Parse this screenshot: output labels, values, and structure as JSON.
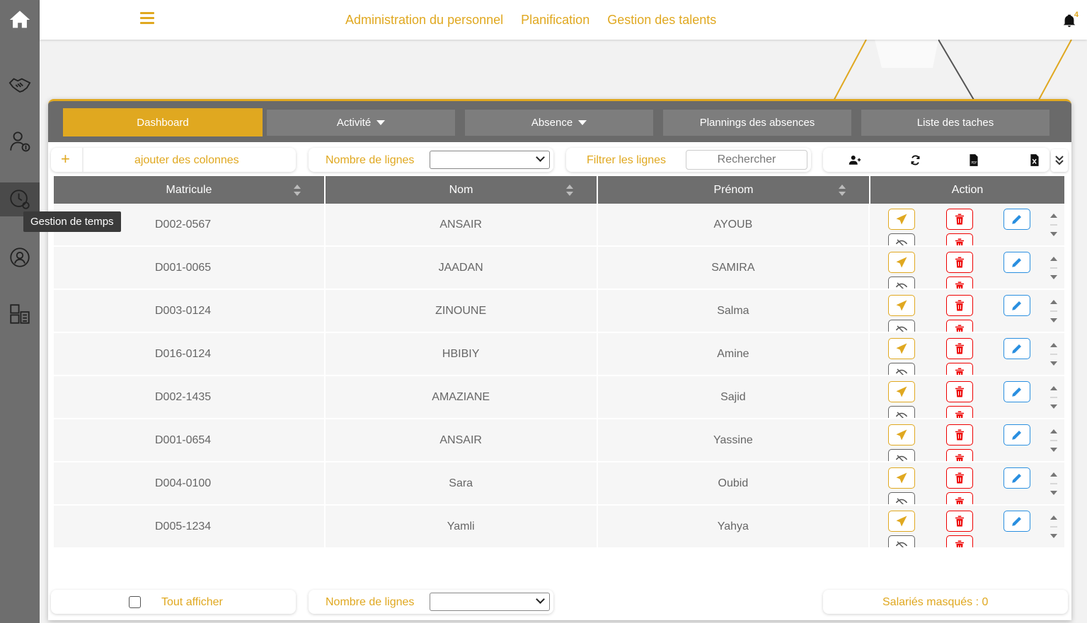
{
  "tooltip": "Gestion de temps",
  "topnav": {
    "items": [
      "Administration du personnel",
      "Planification",
      "Gestion des talents"
    ],
    "notification_count": "4"
  },
  "tabs": [
    {
      "label": "Dashboard",
      "active": true
    },
    {
      "label": "Activité",
      "dropdown": true
    },
    {
      "label": "Absence",
      "dropdown": true
    },
    {
      "label": "Plannings des absences"
    },
    {
      "label": "Liste des taches"
    }
  ],
  "toolbar": {
    "add_columns": "ajouter des colonnes",
    "rows_label": "Nombre de lignes",
    "filter_label": "Filtrer les lignes",
    "search_placeholder": "Rechercher"
  },
  "table": {
    "columns": [
      "Matricule",
      "Nom",
      "Prénom",
      "Action"
    ],
    "rows": [
      [
        "D002-0567",
        "ANSAIR",
        "AYOUB"
      ],
      [
        "D001-0065",
        "JAADAN",
        "SAMIRA"
      ],
      [
        "D003-0124",
        "ZINOUNE",
        "Salma"
      ],
      [
        "D016-0124",
        "HBIBIY",
        "Amine"
      ],
      [
        "D002-1435",
        "AMAZIANE",
        "Sajid"
      ],
      [
        "D001-0654",
        "ANSAIR",
        "Yassine"
      ],
      [
        "D004-0100",
        "Sara",
        "Oubid"
      ],
      [
        "D005-1234",
        "Yamli",
        "Yahya"
      ]
    ]
  },
  "footer": {
    "show_all": "Tout afficher",
    "rows_label": "Nombre de lignes",
    "hidden_employees": "Salariés masqués : 0"
  },
  "colors": {
    "accent": "#e0a820",
    "delete": "#e00000",
    "edit": "#2a8fe0",
    "sidebar": "#6e6e6e"
  }
}
